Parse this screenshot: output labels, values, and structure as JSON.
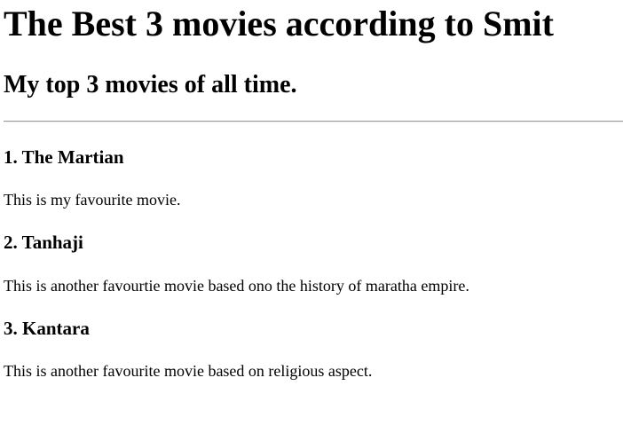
{
  "page": {
    "title": "The Best 3 movies according to Smit",
    "subtitle": "My top 3 movies of all time."
  },
  "movies": [
    {
      "heading": "1. The Martian",
      "description": "This is my favourite movie."
    },
    {
      "heading": "2. Tanhaji",
      "description": "This is another favourtie movie based ono the history of maratha empire."
    },
    {
      "heading": "3. Kantara",
      "description": "This is another favourite movie based on religious aspect."
    }
  ]
}
